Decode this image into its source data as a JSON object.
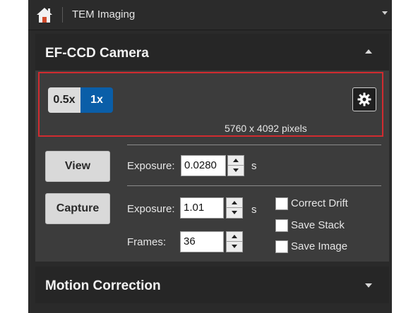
{
  "topbar": {
    "title": "TEM Imaging"
  },
  "panel": {
    "title": "EF-CCD Camera",
    "zoom": {
      "options": [
        "0.5x",
        "1x"
      ],
      "selected": "1x"
    },
    "resolution_text": "5760 x 4092 pixels",
    "view": {
      "button_label": "View",
      "exposure_label": "Exposure:",
      "exposure_value": "0.0280",
      "exposure_unit": "s"
    },
    "capture": {
      "button_label": "Capture",
      "exposure_label": "Exposure:",
      "exposure_value": "1.01",
      "exposure_unit": "s",
      "frames_label": "Frames:",
      "frames_value": "36",
      "options": [
        {
          "label": "Correct Drift",
          "checked": false
        },
        {
          "label": "Save Stack",
          "checked": false
        },
        {
          "label": "Save Image",
          "checked": false
        }
      ]
    }
  },
  "motion": {
    "title": "Motion Correction"
  },
  "colors": {
    "accent": "#0a5ea8",
    "highlight": "#d12b30",
    "panel": "#3c3c3c",
    "header": "#262626"
  },
  "icons": [
    "home-icon",
    "gear-icon",
    "collapse-icon",
    "expand-icon",
    "dropdown-caret-icon"
  ]
}
